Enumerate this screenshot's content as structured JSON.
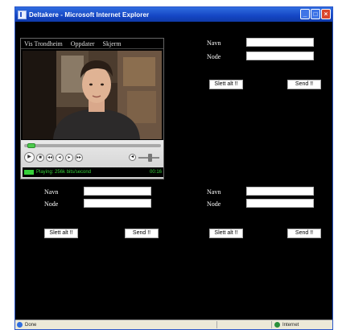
{
  "window": {
    "title": "Deltakere - Microsoft Internet Explorer",
    "buttons": {
      "minimize": "_",
      "maximize": "□",
      "close": "×"
    }
  },
  "player": {
    "menu": [
      "Vis Trondheim",
      "Oppdater",
      "Skjerm"
    ],
    "status": "Playing: 256k bits/second",
    "time": "00:16",
    "controls": [
      "▶",
      "■",
      "◂◂",
      "◂",
      "▸",
      "▸▸"
    ]
  },
  "forms": {
    "top_right": {
      "name_label": "Navn",
      "node_label": "Node",
      "slett_label": "Slett alt !!",
      "send_label": "Send !!"
    },
    "bottom_left": {
      "name_label": "Navn",
      "node_label": "Node",
      "slett_label": "Slett alt !!",
      "send_label": "Send !!"
    },
    "bottom_right": {
      "name_label": "Navn",
      "node_label": "Node",
      "slett_label": "Slett alt !!",
      "send_label": "Send !!"
    }
  },
  "statusbar": {
    "left": "Done",
    "right": "Internet"
  },
  "colors": {
    "background": "#000000",
    "title_blue": "#1546c4",
    "player_status_green": "#36d13a"
  }
}
